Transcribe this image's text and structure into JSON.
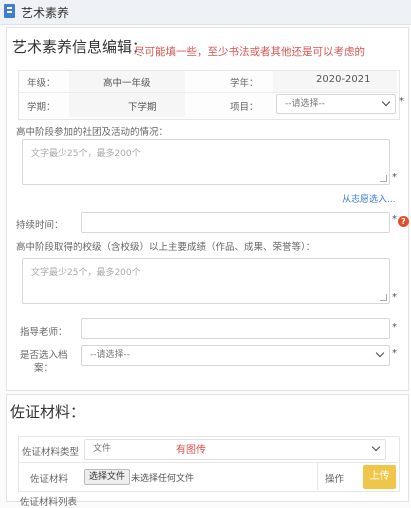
{
  "window": {
    "title": "艺术素养"
  },
  "editor": {
    "title": "艺术素养信息编辑：",
    "hint": "尽可能填一些，至少书法或者其他还是可以考虑的"
  },
  "info": {
    "grade_label": "年级：",
    "grade_value": "高中一年级",
    "year_label": "学年：",
    "year_value": "2020-2021",
    "term_label": "学期：",
    "term_value": "下学期",
    "item_label": "项目：",
    "item_select": "--请选择--"
  },
  "clubs": {
    "label": "高中阶段参加的社团及活动的情况：",
    "placeholder": "文字最少25个，最多200个",
    "link": "从志愿选入..."
  },
  "duration": {
    "label": "持续时间："
  },
  "awards": {
    "label": "高中阶段取得的校级（含校级）以上主要成绩（作品、成果、荣誉等）：",
    "placeholder": "文字最少25个，最多200个"
  },
  "teacher": {
    "label": "指导老师："
  },
  "archive": {
    "label_line1": "是否选入档",
    "label_line2": "案：",
    "select": "--请选择--"
  },
  "evidence": {
    "title": "佐证材料：",
    "type_label": "佐证材料类型",
    "type_value": "文件",
    "type_hint": "有图传",
    "file_label": "佐证材料",
    "choose_button": "选择文件",
    "no_file": "未选择任何文件",
    "action_label": "操作",
    "upload_button": "上传",
    "bottom_label": "佐证材料列表"
  },
  "required_mark": "*",
  "colors": {
    "hint": "#d9534f",
    "link": "#3a7bd5",
    "upload": "#f0c64a",
    "help": "#e0502b"
  }
}
